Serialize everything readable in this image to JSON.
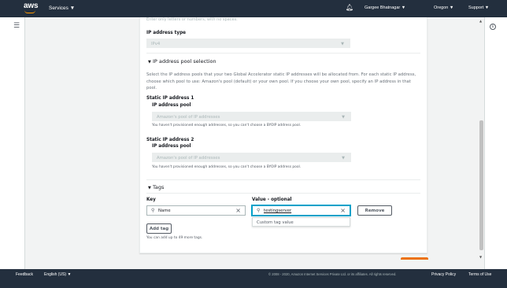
{
  "nav": {
    "logo": "aws",
    "services": "Services ▼",
    "user": "Gargee Bhatnagar ▼",
    "region": "Oregon ▼",
    "support": "Support ▼"
  },
  "form": {
    "name_hint": "Enter only letters or numbers, with no spaces.",
    "ip_address_type_label": "IP address type",
    "ip_address_type_value": "IPv4",
    "pool_section_title": "IP address pool selection",
    "pool_description": "Select the IP address pools that your two Global Accelerator static IP addresses will be allocated from. For each static IP address, choose which pool to use: Amazon's pool (default) or your own pool. If you choose your own pool, specify an IP address in that pool.",
    "static_ip_1": {
      "title": "Static IP address 1",
      "pool_label": "IP address pool",
      "pool_value": "Amazon's pool of IP addresses",
      "note": "You haven't provisioned enough addresses, so you can't choose a BYOIP address pool."
    },
    "static_ip_2": {
      "title": "Static IP address 2",
      "pool_label": "IP address pool",
      "pool_value": "Amazon's pool of IP addresses",
      "note": "You haven't provisioned enough addresses, so you can't choose a BYOIP address pool."
    },
    "tags": {
      "title": "Tags",
      "key_label": "Key",
      "value_label": "Value - optional",
      "key_value": "Name",
      "value_value": "testingserver",
      "remove_label": "Remove",
      "suggestion": "Custom tag value",
      "add_tag_label": "Add tag",
      "limit_note": "You can add up to 49 more tags."
    }
  },
  "footer": {
    "feedback": "Feedback",
    "language": "English (US) ▼",
    "copyright": "© 2008 - 2020, Amazon Internet Services Private Ltd. or its affiliates. All rights reserved.",
    "privacy": "Privacy Policy",
    "terms": "Terms of Use"
  },
  "colors": {
    "nav_bg": "#232f3e",
    "accent_orange": "#ec7211",
    "focus_blue": "#00a1c9"
  },
  "icons": {
    "menu": "hamburger-icon",
    "notifications": "bell-icon",
    "info": "info-icon",
    "search": "search-icon",
    "clear": "close-icon",
    "collapse": "caret-down-icon"
  }
}
